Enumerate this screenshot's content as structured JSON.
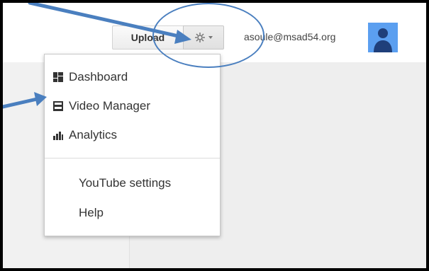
{
  "header": {
    "upload_label": "Upload",
    "account_email": "asoule@msad54.org"
  },
  "menu": {
    "items": [
      {
        "label": "Dashboard",
        "icon": "dashboard-icon"
      },
      {
        "label": "Video Manager",
        "icon": "video-manager-icon"
      },
      {
        "label": "Analytics",
        "icon": "analytics-icon"
      },
      {
        "label": "YouTube settings"
      },
      {
        "label": "Help"
      }
    ]
  },
  "icons": {
    "settings": "gear-icon",
    "avatar": "user-avatar-icon"
  },
  "colors": {
    "annotation_blue": "#4a7fbf",
    "avatar_blue": "#5b9ff0",
    "menu_text": "#333333"
  }
}
